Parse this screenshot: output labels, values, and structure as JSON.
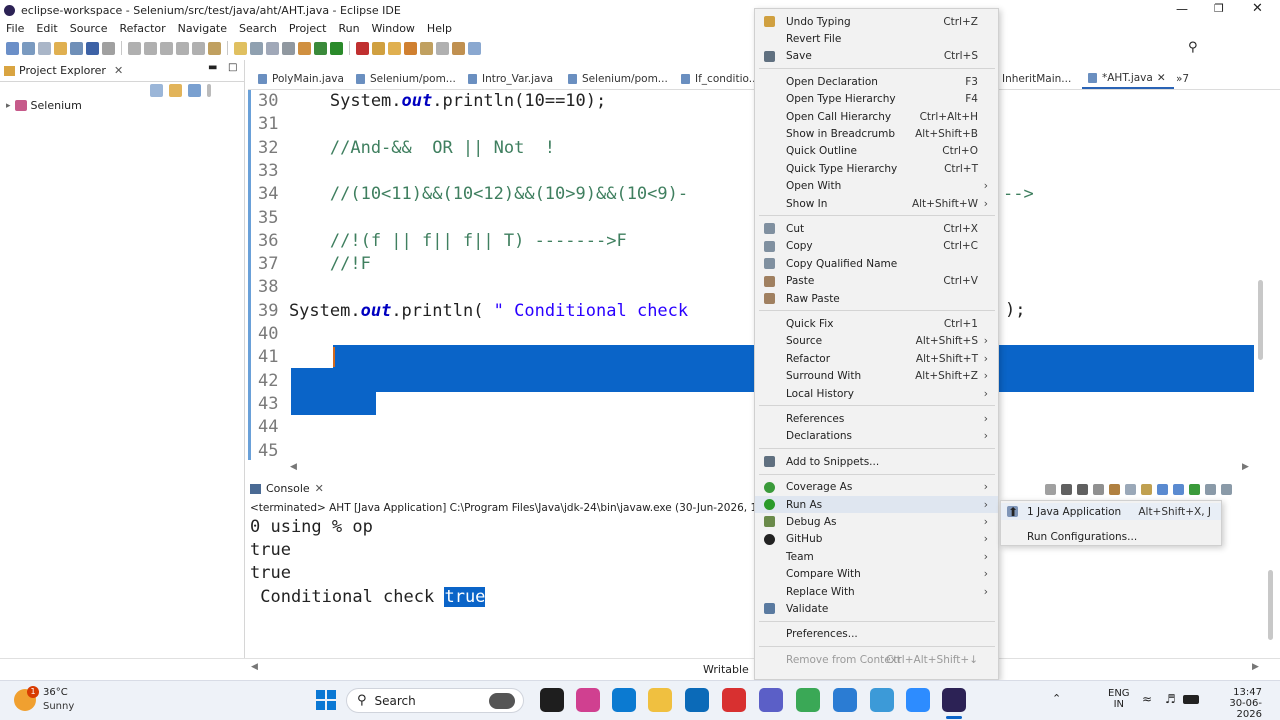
{
  "window": {
    "title": "eclipse-workspace - Selenium/src/test/java/aht/AHT.java - Eclipse IDE"
  },
  "menubar": [
    "File",
    "Edit",
    "Source",
    "Refactor",
    "Navigate",
    "Search",
    "Project",
    "Run",
    "Window",
    "Help"
  ],
  "project_explorer": {
    "title": "Project Explorer",
    "tree": [
      {
        "label": "Selenium"
      }
    ]
  },
  "editor_tabs": [
    {
      "label": "PolyMain.java"
    },
    {
      "label": "Selenium/pom..."
    },
    {
      "label": "Intro_Var.java"
    },
    {
      "label": "Selenium/pom..."
    },
    {
      "label": "If_conditio..."
    },
    {
      "label": "InheritMain..."
    },
    {
      "label": "*AHT.java",
      "active": true
    },
    {
      "label": "»7"
    }
  ],
  "code_lines": [
    {
      "n": "30",
      "text": "        System.out.println(10==10);"
    },
    {
      "n": "31",
      "text": ""
    },
    {
      "n": "32",
      "text": "        //And-&&  OR || Not  !"
    },
    {
      "n": "33",
      "text": ""
    },
    {
      "n": "34",
      "text": "        //(10<11)&&(10<12)&&(10>9)&&(10<9)-"
    },
    {
      "n": "35",
      "text": ""
    },
    {
      "n": "36",
      "text": "        //!(f || f|| f|| T) ------->F"
    },
    {
      "n": "37",
      "text": "        //!F"
    },
    {
      "n": "38",
      "text": ""
    },
    {
      "n": "39",
      "text": "    System.out.println( \" Conditional check"
    },
    {
      "n": "40",
      "text": ""
    },
    {
      "n": "41",
      "text": ""
    },
    {
      "n": "42",
      "text": ""
    },
    {
      "n": "43",
      "text": ""
    },
    {
      "n": "44",
      "text": ""
    },
    {
      "n": "45",
      "text": ""
    }
  ],
  "code_overflow": {
    "line34_tail": "-->",
    "line39_tail": ");"
  },
  "console": {
    "tab": "Console",
    "header": "<terminated> AHT [Java Application] C:\\Program Files\\Java\\jdk-24\\bin\\javaw.exe  (30-Jun-2026, 1:47:44 pm – 1:47:",
    "lines": [
      "0 using % op",
      "true",
      "true",
      " Conditional check "
    ],
    "highlight": "true"
  },
  "context_menu": [
    {
      "label": "Undo Typing",
      "shortcut": "Ctrl+Z",
      "icon": "undo-icon"
    },
    {
      "label": "Revert File"
    },
    {
      "label": "Save",
      "shortcut": "Ctrl+S",
      "icon": "save-icon"
    },
    {
      "sep": true
    },
    {
      "label": "Open Declaration",
      "shortcut": "F3"
    },
    {
      "label": "Open Type Hierarchy",
      "shortcut": "F4"
    },
    {
      "label": "Open Call Hierarchy",
      "shortcut": "Ctrl+Alt+H"
    },
    {
      "label": "Show in Breadcrumb",
      "shortcut": "Alt+Shift+B"
    },
    {
      "label": "Quick Outline",
      "shortcut": "Ctrl+O"
    },
    {
      "label": "Quick Type Hierarchy",
      "shortcut": "Ctrl+T"
    },
    {
      "label": "Open With",
      "submenu": true
    },
    {
      "label": "Show In",
      "shortcut": "Alt+Shift+W",
      "submenu": true
    },
    {
      "sep": true
    },
    {
      "label": "Cut",
      "shortcut": "Ctrl+X",
      "icon": "cut-icon"
    },
    {
      "label": "Copy",
      "shortcut": "Ctrl+C",
      "icon": "copy-icon"
    },
    {
      "label": "Copy Qualified Name",
      "icon": "copy-qualified-icon"
    },
    {
      "label": "Paste",
      "shortcut": "Ctrl+V",
      "icon": "paste-icon"
    },
    {
      "label": "Raw Paste",
      "icon": "raw-paste-icon"
    },
    {
      "sep": true
    },
    {
      "label": "Quick Fix",
      "shortcut": "Ctrl+1"
    },
    {
      "label": "Source",
      "shortcut": "Alt+Shift+S",
      "submenu": true
    },
    {
      "label": "Refactor",
      "shortcut": "Alt+Shift+T",
      "submenu": true
    },
    {
      "label": "Surround With",
      "shortcut": "Alt+Shift+Z",
      "submenu": true
    },
    {
      "label": "Local History",
      "submenu": true
    },
    {
      "sep": true
    },
    {
      "label": "References",
      "submenu": true
    },
    {
      "label": "Declarations",
      "submenu": true
    },
    {
      "sep": true
    },
    {
      "label": "Add to Snippets...",
      "icon": "snippets-icon"
    },
    {
      "sep": true
    },
    {
      "label": "Coverage As",
      "submenu": true,
      "icon": "coverage-icon"
    },
    {
      "label": "Run As",
      "submenu": true,
      "icon": "run-icon",
      "active": true
    },
    {
      "label": "Debug As",
      "submenu": true,
      "icon": "debug-icon"
    },
    {
      "label": "GitHub",
      "submenu": true,
      "icon": "github-icon"
    },
    {
      "label": "Team",
      "submenu": true
    },
    {
      "label": "Compare With",
      "submenu": true
    },
    {
      "label": "Replace With",
      "submenu": true
    },
    {
      "label": "Validate",
      "icon": "check-icon"
    },
    {
      "sep": true
    },
    {
      "label": "Preferences..."
    },
    {
      "sep": true
    },
    {
      "label": "Remove from Context",
      "shortcut": "Ctrl+Alt+Shift+↓",
      "disabled": true
    }
  ],
  "submenu": [
    {
      "label": "1 Java Application",
      "shortcut": "Alt+Shift+X, J",
      "icon": "java-app-icon"
    },
    {
      "label": "Run Configurations..."
    }
  ],
  "status": {
    "writable": "Writable"
  },
  "taskbar": {
    "weather_temp": "36°C",
    "weather_desc": "Sunny",
    "badge": "1",
    "search": "Search",
    "lang1": "ENG",
    "lang2": "IN",
    "time": "13:47",
    "date": "30-06-2026"
  },
  "colors": {
    "selection": "#0078d7",
    "accent": "#0a64ad"
  }
}
